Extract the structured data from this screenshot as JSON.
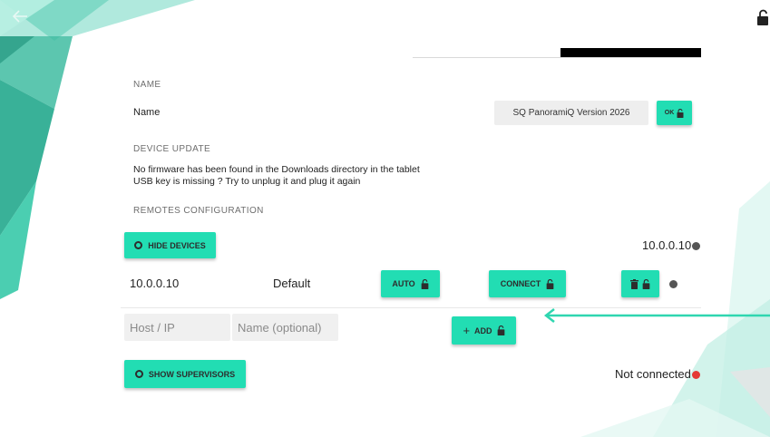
{
  "device": {
    "name_placeholder_bar": ""
  },
  "sections": {
    "name": "NAME",
    "device_update": "DEVICE UPDATE",
    "remotes": "REMOTES CONFIGURATION"
  },
  "name_row": {
    "label": "Name",
    "value": "SQ PanoramiQ Version 2026",
    "ok_label": "OK"
  },
  "device_update": {
    "line1": "No firmware has been found in the Downloads directory in the tablet",
    "line2": "USB key is missing ? Try to unplug it and plug it again"
  },
  "remotes": {
    "hide_devices_label": "HIDE DEVICES",
    "host_status": "10.0.0.10",
    "device_row": {
      "ip": "10.0.0.10",
      "name": "Default",
      "auto_label": "AUTO",
      "connect_label": "CONNECT"
    },
    "add_row": {
      "host_placeholder": "Host / IP",
      "name_placeholder": "Name (optional)",
      "add_label": "ADD"
    },
    "show_supervisors_label": "SHOW SUPERVISORS",
    "supervisor_status": "Not connected"
  },
  "colors": {
    "accent": "#22ddb3",
    "status_grey": "#555555",
    "status_red": "#e53935",
    "arrow": "#2fd6b0"
  },
  "icons": [
    "back-arrow-icon",
    "lock-icon",
    "info-circle-icon",
    "trash-icon",
    "plus-icon",
    "status-dot-icon"
  ]
}
